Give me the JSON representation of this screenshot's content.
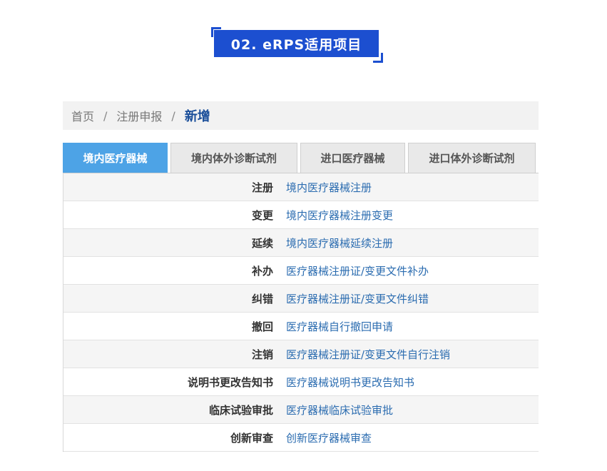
{
  "header": {
    "title": "02. eRPS适用项目"
  },
  "breadcrumb": {
    "items": [
      "首页",
      "注册申报"
    ],
    "separator": "/",
    "current": "新增"
  },
  "tabs": [
    {
      "label": "境内医疗器械",
      "active": true
    },
    {
      "label": "境内体外诊断试剂",
      "active": false
    },
    {
      "label": "进口医疗器械",
      "active": false
    },
    {
      "label": "进口体外诊断试剂",
      "active": false
    }
  ],
  "rows": [
    {
      "key": "注册",
      "value": "境内医疗器械注册"
    },
    {
      "key": "变更",
      "value": "境内医疗器械注册变更"
    },
    {
      "key": "延续",
      "value": "境内医疗器械延续注册"
    },
    {
      "key": "补办",
      "value": "医疗器械注册证/变更文件补办"
    },
    {
      "key": "纠错",
      "value": "医疗器械注册证/变更文件纠错"
    },
    {
      "key": "撤回",
      "value": "医疗器械自行撤回申请"
    },
    {
      "key": "注销",
      "value": "医疗器械注册证/变更文件自行注销"
    },
    {
      "key": "说明书更改告知书",
      "value": "医疗器械说明书更改告知书"
    },
    {
      "key": "临床试验审批",
      "value": "医疗器械临床试验审批"
    },
    {
      "key": "创新审查",
      "value": "创新医疗器械审查"
    }
  ],
  "colors": {
    "accent": "#1c4fd0",
    "active_tab": "#4da3e6",
    "link": "#2b6cb0"
  }
}
